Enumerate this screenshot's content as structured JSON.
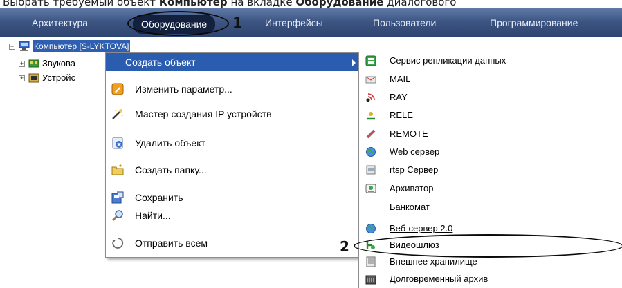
{
  "caption": {
    "prefix": "Выбрать требуемый объект ",
    "bold1": "Компьютер",
    "middle": " на вкладке ",
    "bold2": "Оборудование",
    "suffix": " диалогового"
  },
  "tabs": [
    {
      "label": "Архитектура"
    },
    {
      "label": "Оборудование"
    },
    {
      "label": "Интерфейсы"
    },
    {
      "label": "Пользователи"
    },
    {
      "label": "Программирование"
    }
  ],
  "tree": {
    "root_label": "Компьютер [S-LYKTOVA]",
    "child1_label": "Звукова",
    "child2_label": "Устройс"
  },
  "context_menu": {
    "items": [
      {
        "label": "Создать объект",
        "icon": "none"
      },
      {
        "label": "Изменить параметр...",
        "icon": "edit-icon"
      },
      {
        "label": "Мастер создания IP устройств",
        "icon": "wizard-icon"
      },
      {
        "label": "Удалить объект",
        "icon": "delete-icon"
      },
      {
        "label": "Создать папку...",
        "icon": "folder-icon"
      },
      {
        "label": "Сохранить",
        "icon": "save-icon"
      },
      {
        "label": "Найти...",
        "icon": "search-icon"
      },
      {
        "label": "Отправить всем",
        "icon": "send-icon"
      }
    ]
  },
  "submenu": {
    "items": [
      {
        "label": "Сервис репликации данных",
        "icon": "replication-icon"
      },
      {
        "label": "MAIL",
        "icon": "mail-icon"
      },
      {
        "label": "RAY",
        "icon": "ray-icon"
      },
      {
        "label": "RELE",
        "icon": "relay-icon"
      },
      {
        "label": "REMOTE",
        "icon": "remote-icon"
      },
      {
        "label": "Web сервер",
        "icon": "web-server-icon"
      },
      {
        "label": "rtsp Сервер",
        "icon": "rtsp-icon"
      },
      {
        "label": "Архиватор",
        "icon": "archiver-icon"
      },
      {
        "label": "Банкомат",
        "icon": "none"
      },
      {
        "label": "Веб-сервер 2.0",
        "icon": "web-server-2-icon"
      },
      {
        "label": "Видеошлюз",
        "icon": "video-gateway-icon"
      },
      {
        "label": "Внешнее хранилище",
        "icon": "storage-icon"
      },
      {
        "label": "Долговременный архив",
        "icon": "longterm-archive-icon"
      }
    ]
  },
  "markers": {
    "step1": "1",
    "step2": "2"
  },
  "colors": {
    "tabbar": "#3d5583",
    "active_tab": "#13213e",
    "menu_highlight": "#2a5db0"
  }
}
